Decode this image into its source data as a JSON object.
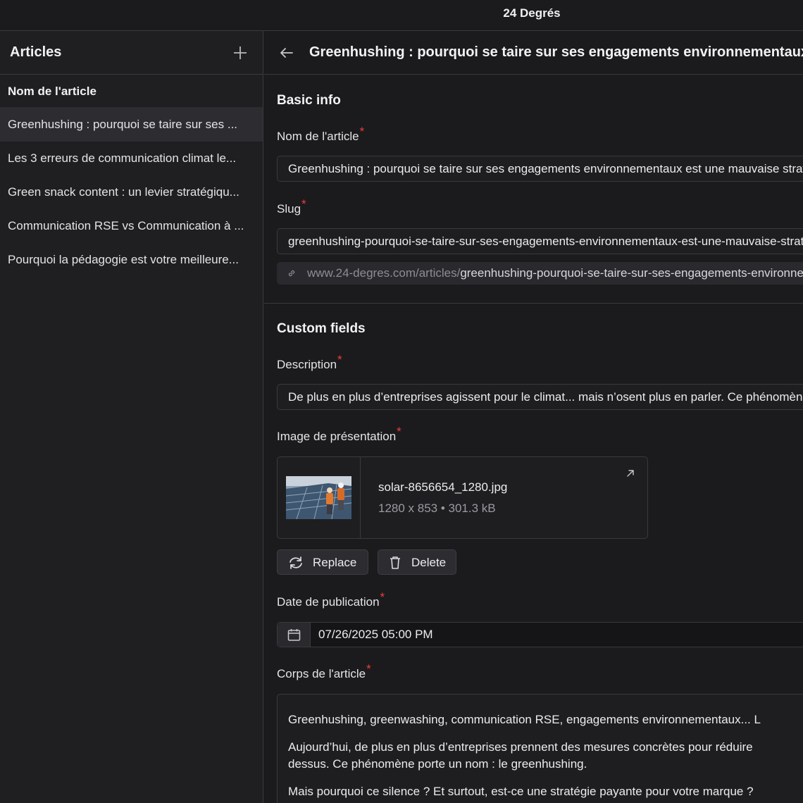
{
  "app": {
    "title": "24 Degrés"
  },
  "sidebar": {
    "title": "Articles",
    "column_header": "Nom de l'article",
    "items": [
      {
        "label": "Greenhushing : pourquoi se taire sur ses ...",
        "active": true
      },
      {
        "label": "Les 3 erreurs de communication climat le...",
        "active": false
      },
      {
        "label": "Green snack content : un levier stratégiqu...",
        "active": false
      },
      {
        "label": "Communication RSE vs Communication à ...",
        "active": false
      },
      {
        "label": "Pourquoi la pédagogie est votre meilleure...",
        "active": false
      }
    ]
  },
  "header": {
    "title": "Greenhushing : pourquoi se taire sur ses engagements environnementaux est une mauvaise stratégie"
  },
  "basic_info": {
    "section_title": "Basic info",
    "name_label": "Nom de l'article",
    "name_value": "Greenhushing : pourquoi se taire sur ses engagements environnementaux est une mauvaise stratégie",
    "slug_label": "Slug",
    "slug_value": "greenhushing-pourquoi-se-taire-sur-ses-engagements-environnementaux-est-une-mauvaise-strategie",
    "url_base": "www.24-degres.com/articles/",
    "url_slug": "greenhushing-pourquoi-se-taire-sur-ses-engagements-environnementaux-est-une-mauvaise-strategie"
  },
  "custom_fields": {
    "section_title": "Custom fields",
    "description_label": "Description",
    "description_value": "De plus en plus d’entreprises agissent pour le climat... mais n’osent plus en parler. Ce phénomène porte un nom : le greenhushing.",
    "image_label": "Image de présentation",
    "image": {
      "file_name": "solar-8656654_1280.jpg",
      "meta": "1280 x 853 • 301.3 kB",
      "replace_label": "Replace",
      "delete_label": "Delete"
    },
    "date_label": "Date de publication",
    "date_value": "07/26/2025 05:00 PM",
    "body_label": "Corps de l'article",
    "body_paragraphs": [
      "Greenhushing, greenwashing, communication RSE, engagements environnementaux... L",
      "Aujourd’hui, de plus en plus d’entreprises prennent des mesures concrètes pour réduire",
      "dessus. Ce phénomène porte un nom : le greenhushing.",
      "Mais pourquoi ce silence ? Et surtout, est-ce une stratégie payante pour votre marque ?"
    ]
  },
  "icons": {
    "add": "plus-icon",
    "back": "arrow-left-icon",
    "link": "link-icon",
    "open": "arrow-up-right-icon",
    "replace": "refresh-icon",
    "delete": "trash-icon",
    "calendar": "calendar-icon"
  },
  "colors": {
    "required": "#ef3d3d",
    "background": "#1b1b1d",
    "sidebar": "#1f1f22",
    "active_item": "#2d2d31"
  }
}
